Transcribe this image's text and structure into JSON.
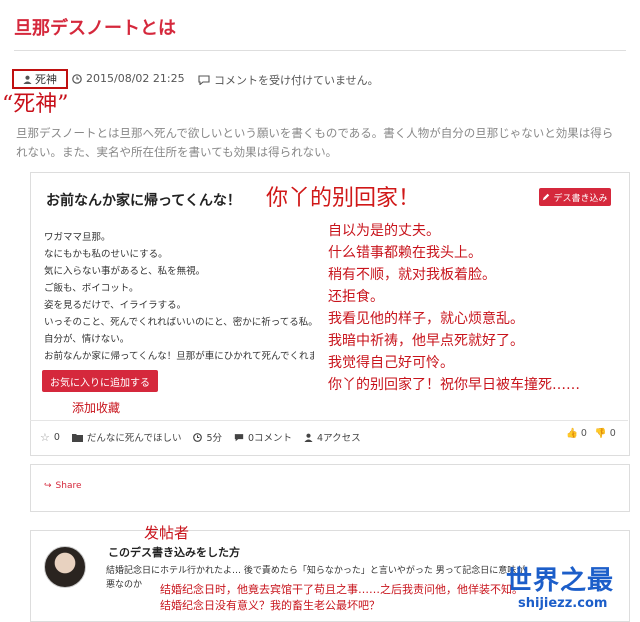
{
  "page_title": "旦那デスノートとは",
  "meta": {
    "author": "死神",
    "datetime": "2015/08/02 21:25",
    "comments_status": "コメントを受け付けていません。"
  },
  "author_annotation": "“死神”",
  "description_lines": [
    "旦那デスノートとは旦那へ死んで欲しいという願いを書くものである。書く人物が自分の旦那じゃないと効果は得ら",
    "れない。また、実名や所在住所を書いても効果は得られない。"
  ],
  "post": {
    "title": "お前なんか家に帰ってくんな！",
    "title_annotation": "你丫的别回家！",
    "write_button": "デス書き込み",
    "lines": [
      "ワガママ旦那。",
      "なにもかも私のせいにする。",
      "気に入らない事があると、私を無視。",
      "ご飯も、ボイコット。",
      "姿を見るだけで、イライラする。",
      "いっそのこと、死んでくれればいいのにと、密かに祈ってる私。",
      "自分が、情けない。",
      "お前なんか家に帰ってくんな！旦那が車にひかれて死んでくれます様に…"
    ],
    "translation_lines": [
      "自以为是的丈夫。",
      "什么错事都赖在我头上。",
      "稍有不顺，就对我板着脸。",
      "还拒食。",
      "我看见他的样子，就心烦意乱。",
      "我暗中祈祷，他早点死就好了。",
      "我觉得自己好可怜。",
      "你丫的别回家了！祝你早日被车撞死……"
    ],
    "favorite_button": "お気に入りに追加する",
    "favorite_annotation": "添加收藏",
    "stats": {
      "likes": "0",
      "category": "だんなに死んでほしい",
      "time": "5分",
      "comments": "0コメント",
      "access": "4アクセス"
    },
    "votes": {
      "up": "0",
      "down": "0"
    }
  },
  "share_label": "Share",
  "poster_annotation": "发帖者",
  "comment": {
    "title": "このデス書き込みをした方",
    "body_lines": [
      "結婚記念日にホテル行かれたよ… 後で責めたら「知らなかった」と言いやがった 男って記念日に意味がないの…",
      "悪なのか"
    ],
    "translation_lines": [
      "结婚纪念日时，他竟去宾馆干了苟且之事……之后我责问他，他佯装不知。",
      "结婚纪念日没有意义？我的畜生老公最坏吧？"
    ]
  },
  "watermark": {
    "main": "世界之最",
    "sub": "shijiezz.com"
  },
  "colors": {
    "accent": "#d5283c",
    "annotation": "#c8141c",
    "watermark": "#1c5ec9"
  }
}
